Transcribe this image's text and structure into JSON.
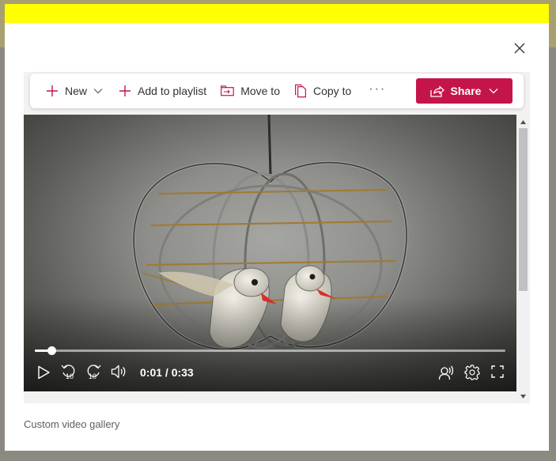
{
  "toolbar": {
    "new_label": "New",
    "add_playlist_label": "Add to playlist",
    "move_label": "Move to",
    "copy_label": "Copy to",
    "more_label": "···",
    "share_label": "Share"
  },
  "player": {
    "time": "0:01 / 0:33",
    "progress_fraction": 0.036,
    "skip_back_seconds": "10",
    "skip_forward_seconds": "10"
  },
  "caption": "Custom video gallery",
  "colors": {
    "accent": "#c4154a",
    "highlight_bar": "#ffff00"
  },
  "icons": [
    "close-icon",
    "plus-icon",
    "chevron-down-icon",
    "move-icon",
    "copy-icon",
    "share-icon",
    "play-icon",
    "skip-back-icon",
    "skip-forward-icon",
    "volume-icon",
    "captions-icon",
    "settings-icon",
    "fullscreen-icon"
  ]
}
